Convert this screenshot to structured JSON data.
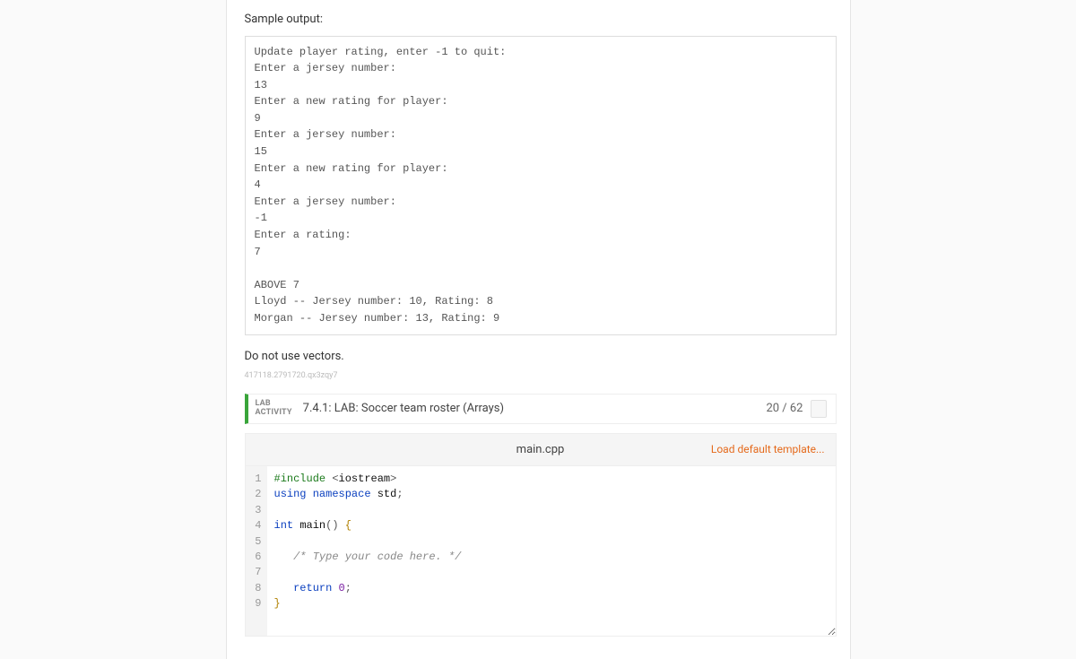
{
  "sample_output_label": "Sample output:",
  "sample_output_lines": [
    "Update player rating, enter -1 to quit:",
    "Enter a jersey number:",
    "13",
    "Enter a new rating for player:",
    "9",
    "Enter a jersey number:",
    "15",
    "Enter a new rating for player:",
    "4",
    "Enter a jersey number:",
    "-1",
    "Enter a rating:",
    "7",
    "",
    "ABOVE 7",
    "Lloyd -- Jersey number: 10, Rating: 8",
    "Morgan -- Jersey number: 13, Rating: 9"
  ],
  "no_vectors_text": "Do not use vectors.",
  "qid_text": "417118.2791720.qx3zqy7",
  "activity": {
    "tag_line1": "LAB",
    "tag_line2": "ACTIVITY",
    "title": "7.4.1: LAB: Soccer team roster (Arrays)",
    "score": "20 / 62"
  },
  "file_tab": {
    "filename": "main.cpp",
    "load_template": "Load default template..."
  },
  "code_lines": [
    {
      "n": 1,
      "tokens": [
        {
          "cls": "tok-pp",
          "t": "#include "
        },
        {
          "cls": "tok-pn",
          "t": "<"
        },
        {
          "cls": "tok-id",
          "t": "iostream"
        },
        {
          "cls": "tok-pn",
          "t": ">"
        }
      ]
    },
    {
      "n": 2,
      "tokens": [
        {
          "cls": "tok-kw",
          "t": "using "
        },
        {
          "cls": "tok-kw",
          "t": "namespace "
        },
        {
          "cls": "tok-id",
          "t": "std"
        },
        {
          "cls": "tok-pn",
          "t": ";"
        }
      ]
    },
    {
      "n": 3,
      "tokens": []
    },
    {
      "n": 4,
      "tokens": [
        {
          "cls": "tok-kw",
          "t": "int "
        },
        {
          "cls": "tok-id",
          "t": "main"
        },
        {
          "cls": "tok-pn",
          "t": "() "
        },
        {
          "cls": "tok-br",
          "t": "{"
        }
      ]
    },
    {
      "n": 5,
      "tokens": []
    },
    {
      "n": 6,
      "tokens": [
        {
          "cls": "",
          "t": "   "
        },
        {
          "cls": "tok-cm",
          "t": "/* Type your code here. */"
        }
      ]
    },
    {
      "n": 7,
      "tokens": []
    },
    {
      "n": 8,
      "tokens": [
        {
          "cls": "",
          "t": "   "
        },
        {
          "cls": "tok-kw",
          "t": "return "
        },
        {
          "cls": "tok-num",
          "t": "0"
        },
        {
          "cls": "tok-pn",
          "t": ";"
        }
      ]
    },
    {
      "n": 9,
      "tokens": [
        {
          "cls": "tok-br",
          "t": "}"
        }
      ]
    }
  ]
}
